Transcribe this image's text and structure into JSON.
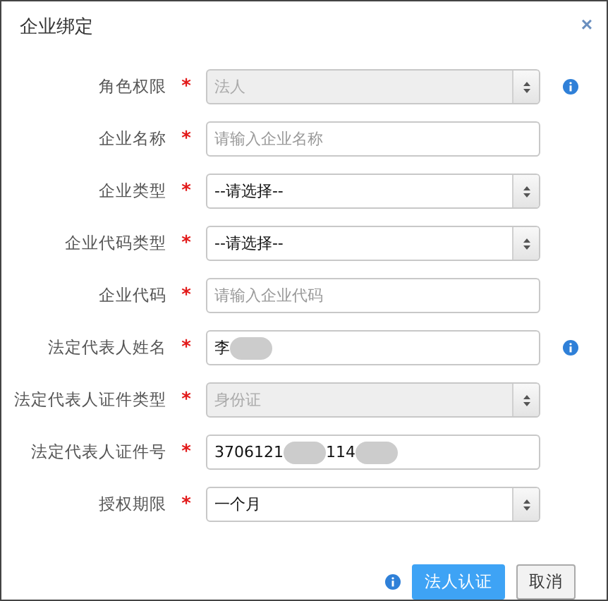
{
  "dialog": {
    "title": "企业绑定",
    "close": "×"
  },
  "rows": [
    {
      "label": "角色权限",
      "required": "*",
      "kind": "select",
      "value": "法人",
      "disabled": true,
      "info": true
    },
    {
      "label": "企业名称",
      "required": "*",
      "kind": "input",
      "placeholder": "请输入企业名称",
      "disabled": false,
      "info": false
    },
    {
      "label": "企业类型",
      "required": "*",
      "kind": "select",
      "value": "--请选择--",
      "disabled": false,
      "info": false
    },
    {
      "label": "企业代码类型",
      "required": "*",
      "kind": "select",
      "value": "--请选择--",
      "disabled": false,
      "info": false
    },
    {
      "label": "企业代码",
      "required": "*",
      "kind": "input",
      "placeholder": "请输入企业代码",
      "disabled": false,
      "info": false
    },
    {
      "label": "法定代表人姓名",
      "required": "*",
      "kind": "redacted",
      "parts": [
        "李"
      ],
      "disabled": false,
      "info": true
    },
    {
      "label": "法定代表人证件类型",
      "required": "*",
      "kind": "select",
      "value": "身份证",
      "disabled": true,
      "info": false
    },
    {
      "label": "法定代表人证件号",
      "required": "*",
      "kind": "redacted",
      "parts": [
        "3706121",
        "114"
      ],
      "disabled": false,
      "info": false
    },
    {
      "label": "授权期限",
      "required": "*",
      "kind": "select",
      "value": "一个月",
      "disabled": false,
      "info": false
    }
  ],
  "footer": {
    "info": true,
    "buttons": [
      {
        "label": "法人认证",
        "kind": "primary"
      },
      {
        "label": "取消",
        "kind": "default"
      }
    ]
  }
}
